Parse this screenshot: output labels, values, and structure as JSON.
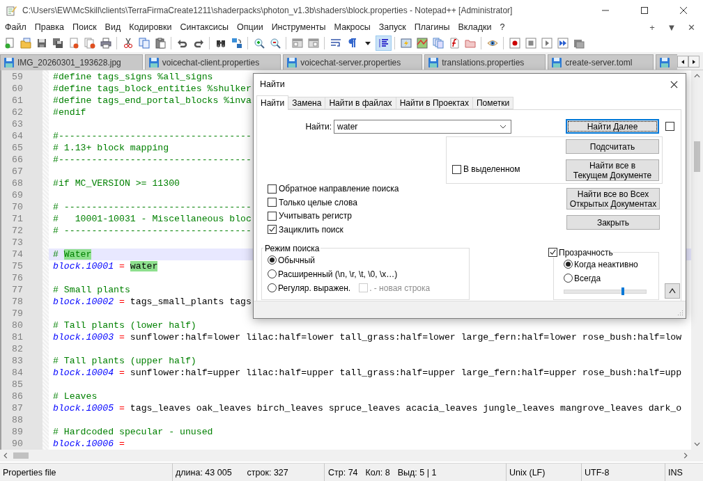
{
  "window": {
    "title": "C:\\Users\\EW\\McSkill\\clients\\TerraFirmaCreate1211\\shaderpacks\\photon_v1.3b\\shaders\\block.properties - Notepad++ [Administrator]"
  },
  "menu": [
    "Файл",
    "Правка",
    "Поиск",
    "Вид",
    "Кодировки",
    "Синтаксисы",
    "Опции",
    "Инструменты",
    "Макросы",
    "Запуск",
    "Плагины",
    "Вкладки",
    "?"
  ],
  "menu_controls": [
    "+",
    "▼",
    "✕"
  ],
  "toolbar": [
    {
      "pressed": false
    },
    {
      "pressed": false
    },
    {
      "pressed": false
    },
    {
      "pressed": false
    },
    {
      "pressed": false
    },
    {
      "pressed": false
    },
    {
      "pressed": false
    },
    {
      "pressed": false
    },
    {
      "pressed": false
    },
    {
      "pressed": false
    },
    {
      "pressed": false
    },
    {
      "pressed": false
    },
    {
      "pressed": false
    },
    {
      "pressed": false
    },
    {
      "pressed": false
    },
    {
      "pressed": false
    },
    {
      "pressed": false
    },
    {
      "pressed": false
    },
    {
      "pressed": false
    },
    {
      "pressed": false
    },
    {
      "pressed": false
    },
    {
      "pressed": true
    },
    {
      "pressed": false
    },
    {
      "pressed": false
    },
    {
      "pressed": false
    },
    {
      "pressed": false
    },
    {
      "pressed": false
    },
    {
      "pressed": false
    },
    {
      "pressed": false
    },
    {
      "pressed": false
    },
    {
      "pressed": false
    },
    {
      "pressed": false
    },
    {
      "pressed": false
    }
  ],
  "tabs": [
    {
      "label": "IMG_20260301_193628.jpg",
      "selected": false
    },
    {
      "label": "voicechat-client.properties",
      "selected": false
    },
    {
      "label": "voicechat-server.properties",
      "selected": false
    },
    {
      "label": "translations.properties",
      "selected": false
    },
    {
      "label": "create-server.toml",
      "selected": false
    },
    {
      "selected": false
    }
  ],
  "editor": {
    "lines": [
      {
        "number": "59",
        "current": false,
        "tokens": [
          {
            "kind": "comment",
            "text": "#define tags_signs %all_signs"
          }
        ]
      },
      {
        "number": "60",
        "current": false,
        "tokens": [
          {
            "kind": "comment",
            "text": "#define tags_block_entities %shulker"
          }
        ]
      },
      {
        "number": "61",
        "current": false,
        "tokens": [
          {
            "kind": "comment",
            "text": "#define tags_end_portal_blocks %inva"
          }
        ]
      },
      {
        "number": "62",
        "current": false,
        "tokens": [
          {
            "kind": "comment",
            "text": "#endif"
          }
        ]
      },
      {
        "number": "63",
        "current": false
      },
      {
        "number": "64",
        "current": false,
        "tokens": [
          {
            "kind": "comment",
            "text": "#-----------------------------------"
          }
        ]
      },
      {
        "number": "65",
        "current": false,
        "tokens": [
          {
            "kind": "comment",
            "text": "# 1.13+ block mapping"
          }
        ]
      },
      {
        "number": "66",
        "current": false,
        "tokens": [
          {
            "kind": "comment",
            "text": "#-----------------------------------"
          }
        ]
      },
      {
        "number": "67",
        "current": false
      },
      {
        "number": "68",
        "current": false,
        "tokens": [
          {
            "kind": "comment",
            "text": "#if MC_VERSION >= 11300"
          }
        ]
      },
      {
        "number": "69",
        "current": false
      },
      {
        "number": "70",
        "current": false,
        "tokens": [
          {
            "kind": "comment",
            "text": "# ----------------------------------"
          }
        ]
      },
      {
        "number": "71",
        "current": false,
        "tokens": [
          {
            "kind": "comment",
            "text": "#   10001-10031 - Miscellaneous bloc"
          }
        ]
      },
      {
        "number": "72",
        "current": false,
        "tokens": [
          {
            "kind": "comment",
            "text": "# ----------------------------------"
          }
        ]
      },
      {
        "number": "73",
        "current": false
      },
      {
        "number": "74",
        "current": true,
        "tokens": [
          {
            "kind": "comment",
            "text": "# "
          },
          {
            "kind": "comment_match",
            "text": "Water"
          }
        ]
      },
      {
        "number": "75",
        "current": false,
        "tokens": [
          {
            "kind": "key",
            "text": "block.10001"
          },
          {
            "kind": "op",
            "text": " = "
          },
          {
            "kind": "value_match",
            "text": "water"
          }
        ]
      },
      {
        "number": "76",
        "current": false
      },
      {
        "number": "77",
        "current": false,
        "tokens": [
          {
            "kind": "comment",
            "text": "# Small plants"
          }
        ]
      },
      {
        "number": "78",
        "current": false,
        "tokens": [
          {
            "kind": "key",
            "text": "block.10002"
          },
          {
            "kind": "op",
            "text": " = "
          },
          {
            "kind": "value",
            "text": "tags_small_plants tags"
          }
        ]
      },
      {
        "number": "79",
        "current": false
      },
      {
        "number": "80",
        "current": false,
        "tokens": [
          {
            "kind": "comment",
            "text": "# Tall plants (lower half)"
          }
        ]
      },
      {
        "number": "81",
        "current": false,
        "tokens": [
          {
            "kind": "key",
            "text": "block.10003"
          },
          {
            "kind": "op",
            "text": " = "
          },
          {
            "kind": "value",
            "text": "sunflower:half=lower lilac:half=lower tall_grass:half=lower large_fern:half=lower rose_bush:half=low"
          }
        ]
      },
      {
        "number": "82",
        "current": false
      },
      {
        "number": "83",
        "current": false,
        "tokens": [
          {
            "kind": "comment",
            "text": "# Tall plants (upper half)"
          }
        ]
      },
      {
        "number": "84",
        "current": false,
        "tokens": [
          {
            "kind": "key",
            "text": "block.10004"
          },
          {
            "kind": "op",
            "text": " = "
          },
          {
            "kind": "value",
            "text": "sunflower:half=upper lilac:half=upper tall_grass:half=upper large_fern:half=upper rose_bush:half=upp"
          }
        ]
      },
      {
        "number": "85",
        "current": false
      },
      {
        "number": "86",
        "current": false,
        "tokens": [
          {
            "kind": "comment",
            "text": "# Leaves"
          }
        ]
      },
      {
        "number": "87",
        "current": false,
        "tokens": [
          {
            "kind": "key",
            "text": "block.10005"
          },
          {
            "kind": "op",
            "text": " = "
          },
          {
            "kind": "value",
            "text": "tags_leaves oak_leaves birch_leaves spruce_leaves acacia_leaves jungle_leaves mangrove_leaves dark_o"
          }
        ]
      },
      {
        "number": "88",
        "current": false
      },
      {
        "number": "89",
        "current": false,
        "tokens": [
          {
            "kind": "comment",
            "text": "# Hardcoded specular - unused"
          }
        ]
      },
      {
        "number": "90",
        "current": false,
        "tokens": [
          {
            "kind": "key",
            "text": "block.10006"
          },
          {
            "kind": "op",
            "text": " ="
          }
        ]
      }
    ]
  },
  "find_dialog": {
    "title": "Найти",
    "tabs": [
      {
        "label": "Найти",
        "selected": true
      },
      {
        "label": "Замена",
        "selected": false
      },
      {
        "label": "Найти в файлах",
        "selected": false
      },
      {
        "label": "Найти в Проектах",
        "selected": false
      },
      {
        "label": "Пометки",
        "selected": false
      }
    ],
    "find_label": "Найти:",
    "find_value": "water",
    "find_next": "Найти Далее",
    "side_checkbox": {
      "checked": false
    },
    "in_selection": {
      "label": "В выделенном",
      "checked": false
    },
    "count": "Подсчитать",
    "find_all_current": [
      "Найти все в",
      "Текущем Документе"
    ],
    "find_all_open": [
      "Найти все во Всех",
      "Открытых Документах"
    ],
    "close": "Закрыть",
    "options": [
      {
        "label": "Обратное направление поиска",
        "checked": false
      },
      {
        "label": "Только целые слова",
        "checked": false
      },
      {
        "label": "Учитывать регистр",
        "checked": false
      },
      {
        "label": "Зациклить поиск",
        "checked": true
      }
    ],
    "search_mode": {
      "title": "Режим поиска",
      "options": [
        {
          "label": "Обычный",
          "selected": true
        },
        {
          "label": "Расширенный (\\n, \\r, \\t, \\0, \\x…)",
          "selected": false
        },
        {
          "label": "Регуляр. выражен.",
          "selected": false
        }
      ],
      "newline": {
        "label": ". - новая строка",
        "checked": false,
        "disabled": true
      }
    },
    "transparency": {
      "label": "Прозрачность",
      "checked": true,
      "options": [
        {
          "label": "Когда неактивно",
          "selected": true
        },
        {
          "label": "Всегда",
          "selected": false
        }
      ],
      "level": 0.72
    }
  },
  "status_bar": {
    "file_type": "Properties file",
    "length": "длина: 43 005",
    "lines": "строк: 327",
    "line": "Стр: 74",
    "column": "Кол: 8",
    "selection": "Выд: 5 | 1",
    "eol": "Unix (LF)",
    "encoding": "UTF-8",
    "mode": "INS"
  }
}
